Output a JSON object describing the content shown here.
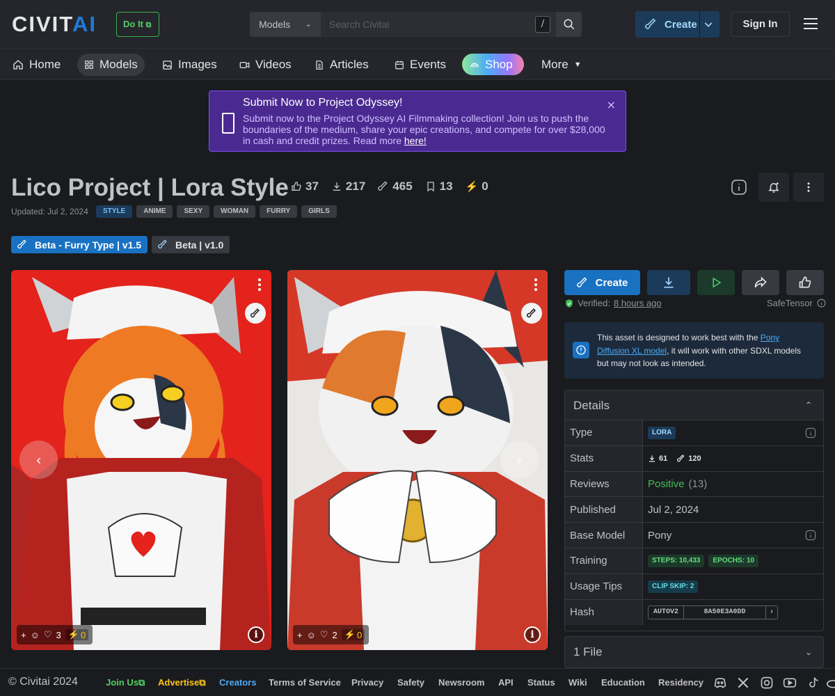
{
  "header": {
    "logo_main": "CIVIT",
    "logo_accent": "AI",
    "doit_label": "Do It",
    "search_scope": "Models",
    "search_placeholder": "Search Civitai",
    "search_shortcut": "/",
    "create_label": "Create",
    "signin_label": "Sign In"
  },
  "nav": {
    "items": [
      {
        "label": "Home",
        "icon": "home-icon"
      },
      {
        "label": "Models",
        "icon": "grid-icon"
      },
      {
        "label": "Images",
        "icon": "image-icon"
      },
      {
        "label": "Videos",
        "icon": "video-icon"
      },
      {
        "label": "Articles",
        "icon": "article-icon"
      },
      {
        "label": "Events",
        "icon": "calendar-icon"
      },
      {
        "label": "Shop",
        "icon": "rainbow-icon"
      },
      {
        "label": "More",
        "icon": "caret-down-icon"
      }
    ]
  },
  "banner": {
    "title": "Submit Now to Project Odyssey!",
    "text": "Submit now to the Project Odyssey AI Filmmaking collection! Join us to push the boundaries of the medium, share your epic creations, and compete for over $28,000 in cash and credit prizes. Read more",
    "link": "here!",
    "close": "×"
  },
  "model": {
    "title": "Lico Project | Lora Style",
    "stats": {
      "likes": "37",
      "downloads": "217",
      "generations": "465",
      "bookmarks": "13",
      "buzz": "0"
    },
    "updated": "Updated: Jul 2, 2024",
    "tags": [
      "STYLE",
      "ANIME",
      "SEXY",
      "WOMAN",
      "FURRY",
      "GIRLS"
    ],
    "versions": [
      "Beta - Furry Type | v1.5",
      "Beta | v1.0"
    ]
  },
  "cards": [
    {
      "reactions": "3",
      "buzz": "0"
    },
    {
      "reactions": "2",
      "buzz": "0"
    }
  ],
  "actions": {
    "create": "Create",
    "verified_prefix": "Verified:",
    "verified_time": "8 hours ago",
    "safetensor": "SafeTensor"
  },
  "alert": {
    "pre": "This asset is designed to work best with the",
    "link": "Pony Diffusion XL model",
    "post": ", it will work with other SDXL models but may not look as intended."
  },
  "details": {
    "heading": "Details",
    "rows": {
      "type": {
        "k": "Type",
        "v": "LORA"
      },
      "stats": {
        "k": "Stats",
        "downloads": "61",
        "generations": "120"
      },
      "reviews": {
        "k": "Reviews",
        "v": "Positive",
        "count": "(13)"
      },
      "published": {
        "k": "Published",
        "v": "Jul 2, 2024"
      },
      "base": {
        "k": "Base Model",
        "v": "Pony"
      },
      "training": {
        "k": "Training",
        "steps": "STEPS: 10,433",
        "epochs": "EPOCHS: 10"
      },
      "tips": {
        "k": "Usage Tips",
        "v": "CLIP SKIP: 2"
      },
      "hash": {
        "k": "Hash",
        "algo": "AUTOV2",
        "v": "8A50E3A0DD"
      }
    }
  },
  "files": {
    "heading": "1 File"
  },
  "footer": {
    "copyright": "© Civitai 2024",
    "links": [
      "Join Us",
      "Advertise",
      "Creators",
      "Terms of Service",
      "Privacy",
      "Safety",
      "Newsroom",
      "API",
      "Status",
      "Wiki",
      "Education",
      "Residency"
    ],
    "colors": {
      "join": "#51cf66",
      "advertise": "#fcc419",
      "creators": "#4dabf7"
    }
  }
}
